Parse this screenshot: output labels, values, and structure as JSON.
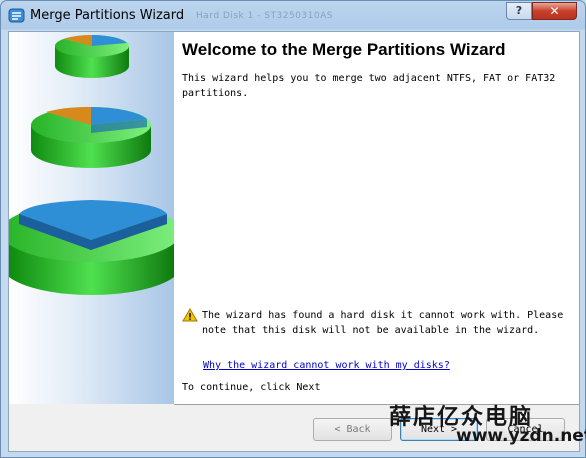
{
  "window": {
    "title": "Merge Partitions Wizard",
    "ghost_title": "Hard Disk 1 - ST3250310AS"
  },
  "titlebar_buttons": {
    "help": "?",
    "close": "✕"
  },
  "content": {
    "heading": "Welcome to the Merge Partitions Wizard",
    "intro": "This wizard helps you to merge two adjacent NTFS, FAT or FAT32 partitions.",
    "warning": "The wizard has found a hard disk it cannot work with. Please note that this disk will not be available in the wizard.",
    "help_link": "Why the wizard cannot work with my disks?",
    "continue_text": "To continue, click Next"
  },
  "buttons": {
    "back": "< Back",
    "next": "Next >",
    "cancel": "Cancel"
  },
  "watermark": {
    "line1": "薛店亿众电脑",
    "line2": "www.yzdn.net"
  },
  "icons": {
    "app": "wizard-disk-icon",
    "warning": "warning-icon",
    "banner": "partition-disks-graphic"
  },
  "colors": {
    "link": "#0000cc",
    "close_button": "#c8412c",
    "disk_green": "#2fbf2f",
    "disk_blue": "#2e8fd6",
    "disk_orange": "#d68a1e"
  }
}
